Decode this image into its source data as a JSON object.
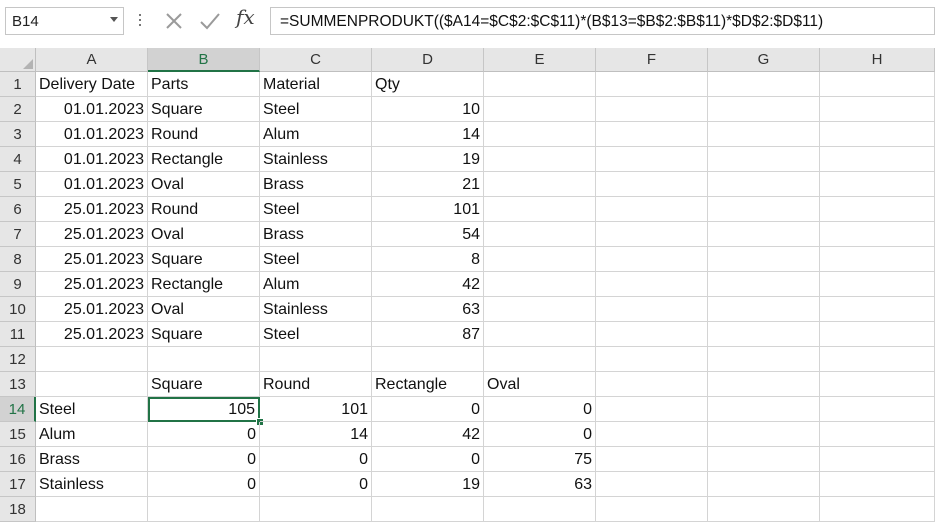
{
  "namebox": {
    "value": "B14"
  },
  "formula": {
    "fx_label": "fx",
    "text": "=SUMMENPRODUKT(($A14=$C$2:$C$11)*(B$13=$B$2:$B$11)*$D$2:$D$11)"
  },
  "columns": [
    "A",
    "B",
    "C",
    "D",
    "E",
    "F",
    "G",
    "H"
  ],
  "selected_column": "B",
  "selected_row": 14,
  "active_cell": "B14",
  "rows": [
    {
      "n": "1",
      "cells": [
        {
          "v": "Delivery Date",
          "a": "l"
        },
        {
          "v": "Parts",
          "a": "l"
        },
        {
          "v": "Material",
          "a": "l"
        },
        {
          "v": "Qty",
          "a": "l"
        },
        {
          "v": "",
          "a": "l"
        }
      ]
    },
    {
      "n": "2",
      "cells": [
        {
          "v": "01.01.2023",
          "a": "r"
        },
        {
          "v": "Square",
          "a": "l"
        },
        {
          "v": "Steel",
          "a": "l"
        },
        {
          "v": "10",
          "a": "r"
        },
        {
          "v": "",
          "a": "l"
        }
      ]
    },
    {
      "n": "3",
      "cells": [
        {
          "v": "01.01.2023",
          "a": "r"
        },
        {
          "v": "Round",
          "a": "l"
        },
        {
          "v": "Alum",
          "a": "l"
        },
        {
          "v": "14",
          "a": "r"
        },
        {
          "v": "",
          "a": "l"
        }
      ]
    },
    {
      "n": "4",
      "cells": [
        {
          "v": "01.01.2023",
          "a": "r"
        },
        {
          "v": "Rectangle",
          "a": "l"
        },
        {
          "v": "Stainless",
          "a": "l"
        },
        {
          "v": "19",
          "a": "r"
        },
        {
          "v": "",
          "a": "l"
        }
      ]
    },
    {
      "n": "5",
      "cells": [
        {
          "v": "01.01.2023",
          "a": "r"
        },
        {
          "v": "Oval",
          "a": "l"
        },
        {
          "v": "Brass",
          "a": "l"
        },
        {
          "v": "21",
          "a": "r"
        },
        {
          "v": "",
          "a": "l"
        }
      ]
    },
    {
      "n": "6",
      "cells": [
        {
          "v": "25.01.2023",
          "a": "r"
        },
        {
          "v": "Round",
          "a": "l"
        },
        {
          "v": "Steel",
          "a": "l"
        },
        {
          "v": "101",
          "a": "r"
        },
        {
          "v": "",
          "a": "l"
        }
      ]
    },
    {
      "n": "7",
      "cells": [
        {
          "v": "25.01.2023",
          "a": "r"
        },
        {
          "v": "Oval",
          "a": "l"
        },
        {
          "v": "Brass",
          "a": "l"
        },
        {
          "v": "54",
          "a": "r"
        },
        {
          "v": "",
          "a": "l"
        }
      ]
    },
    {
      "n": "8",
      "cells": [
        {
          "v": "25.01.2023",
          "a": "r"
        },
        {
          "v": "Square",
          "a": "l"
        },
        {
          "v": "Steel",
          "a": "l"
        },
        {
          "v": "8",
          "a": "r"
        },
        {
          "v": "",
          "a": "l"
        }
      ]
    },
    {
      "n": "9",
      "cells": [
        {
          "v": "25.01.2023",
          "a": "r"
        },
        {
          "v": "Rectangle",
          "a": "l"
        },
        {
          "v": "Alum",
          "a": "l"
        },
        {
          "v": "42",
          "a": "r"
        },
        {
          "v": "",
          "a": "l"
        }
      ]
    },
    {
      "n": "10",
      "cells": [
        {
          "v": "25.01.2023",
          "a": "r"
        },
        {
          "v": "Oval",
          "a": "l"
        },
        {
          "v": "Stainless",
          "a": "l"
        },
        {
          "v": "63",
          "a": "r"
        },
        {
          "v": "",
          "a": "l"
        }
      ]
    },
    {
      "n": "11",
      "cells": [
        {
          "v": "25.01.2023",
          "a": "r"
        },
        {
          "v": "Square",
          "a": "l"
        },
        {
          "v": "Steel",
          "a": "l"
        },
        {
          "v": "87",
          "a": "r"
        },
        {
          "v": "",
          "a": "l"
        }
      ]
    },
    {
      "n": "12",
      "cells": [
        {
          "v": "",
          "a": "l"
        },
        {
          "v": "",
          "a": "l"
        },
        {
          "v": "",
          "a": "l"
        },
        {
          "v": "",
          "a": "l"
        },
        {
          "v": "",
          "a": "l"
        }
      ]
    },
    {
      "n": "13",
      "cells": [
        {
          "v": "",
          "a": "l"
        },
        {
          "v": "Square",
          "a": "l"
        },
        {
          "v": "Round",
          "a": "l"
        },
        {
          "v": "Rectangle",
          "a": "l"
        },
        {
          "v": "Oval",
          "a": "l"
        }
      ]
    },
    {
      "n": "14",
      "cells": [
        {
          "v": "Steel",
          "a": "l"
        },
        {
          "v": "105",
          "a": "r"
        },
        {
          "v": "101",
          "a": "r"
        },
        {
          "v": "0",
          "a": "r"
        },
        {
          "v": "0",
          "a": "r"
        }
      ]
    },
    {
      "n": "15",
      "cells": [
        {
          "v": "Alum",
          "a": "l"
        },
        {
          "v": "0",
          "a": "r"
        },
        {
          "v": "14",
          "a": "r"
        },
        {
          "v": "42",
          "a": "r"
        },
        {
          "v": "0",
          "a": "r"
        }
      ]
    },
    {
      "n": "16",
      "cells": [
        {
          "v": "Brass",
          "a": "l"
        },
        {
          "v": "0",
          "a": "r"
        },
        {
          "v": "0",
          "a": "r"
        },
        {
          "v": "0",
          "a": "r"
        },
        {
          "v": "75",
          "a": "r"
        }
      ]
    },
    {
      "n": "17",
      "cells": [
        {
          "v": "Stainless",
          "a": "l"
        },
        {
          "v": "0",
          "a": "r"
        },
        {
          "v": "0",
          "a": "r"
        },
        {
          "v": "19",
          "a": "r"
        },
        {
          "v": "63",
          "a": "r"
        }
      ]
    },
    {
      "n": "18",
      "cells": [
        {
          "v": "",
          "a": "l"
        },
        {
          "v": "",
          "a": "l"
        },
        {
          "v": "",
          "a": "l"
        },
        {
          "v": "",
          "a": "l"
        },
        {
          "v": "",
          "a": "l"
        }
      ]
    }
  ],
  "colors": {
    "accent": "#217346",
    "header_bg": "#e6e6e6",
    "gridline": "#d4d4d4"
  },
  "icons": {
    "cancel": "close-icon",
    "enter": "check-icon",
    "function": "function-icon",
    "dropdown": "chevron-down-icon"
  }
}
